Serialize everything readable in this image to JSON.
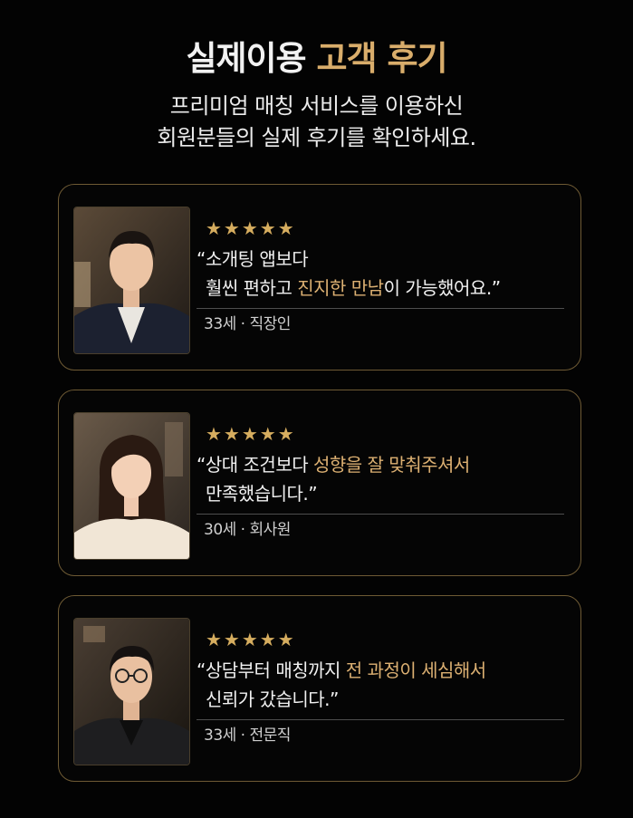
{
  "header": {
    "title_main": "실제이용",
    "title_accent": "고객 후기",
    "subtitle_line1": "프리미엄 매칭 서비스를 이용하신",
    "subtitle_line2": "회원분들의 실제 후기를 확인하세요."
  },
  "colors": {
    "accent": "#d9ad6b",
    "background": "#030303",
    "border": "#6e5a34"
  },
  "reviews": [
    {
      "stars": "★★★★★",
      "rating": 5,
      "quote_l1": "“소개팅 앱보다",
      "quote_l2_pre": "훨씬 편하고 ",
      "quote_l2_hl": "진지한 만남",
      "quote_l2_post": "이 가능했어요.”",
      "meta": "33세 · 직장인"
    },
    {
      "stars": "★★★★★",
      "rating": 5,
      "quote_l1_pre": "“상대 조건보다 ",
      "quote_l1_hl": "성향을 잘 맞춰주셔서",
      "quote_l2": "만족했습니다.”",
      "meta": "30세 · 회사원"
    },
    {
      "stars": "★★★★★",
      "rating": 5,
      "quote_l1_pre": "“상담부터 매칭까지 ",
      "quote_l1_hl": "전 과정이 세심해서",
      "quote_l2": "신뢰가 갔습니다.”",
      "meta": "33세 · 전문직"
    }
  ]
}
